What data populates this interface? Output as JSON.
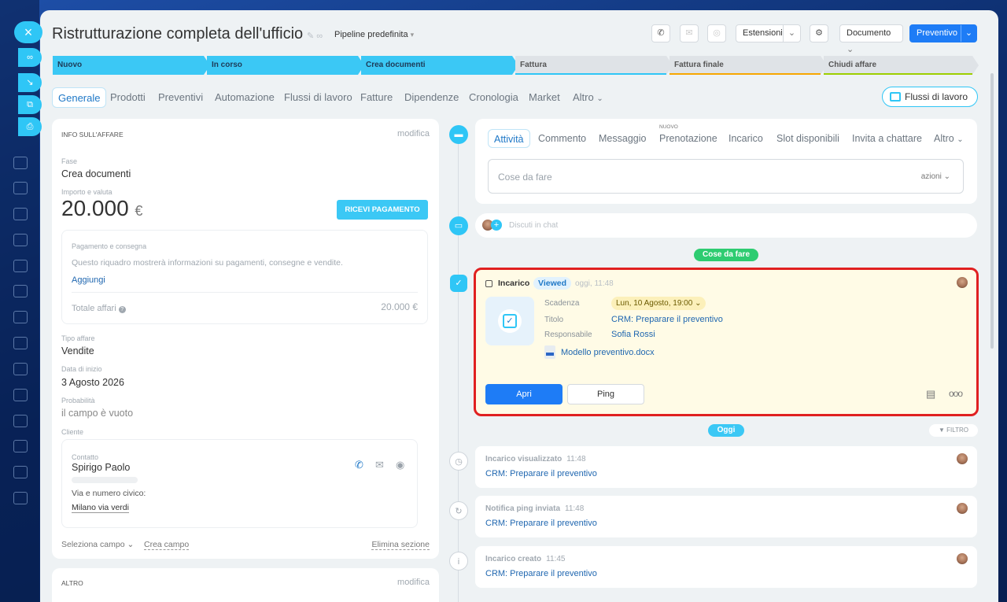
{
  "header": {
    "title": "Ristrutturazione completa dell'ufficio",
    "pipeline": "Pipeline predefinita",
    "extensions": "Estensioni",
    "document": "Documento",
    "quote": "Preventivo"
  },
  "stages": [
    {
      "label": "Nuovo",
      "active": true
    },
    {
      "label": "In corso",
      "active": true
    },
    {
      "label": "Crea documenti",
      "active": true
    },
    {
      "label": "Fattura",
      "active": false,
      "color": "#2fc6f6"
    },
    {
      "label": "Fattura finale",
      "active": false,
      "color": "#f7a700"
    },
    {
      "label": "Chiudi affare",
      "active": false,
      "color": "#9dcf00"
    }
  ],
  "tabs": [
    "Generale",
    "Prodotti",
    "Preventivi",
    "Automazione",
    "Flussi di lavoro",
    "Fatture",
    "Dipendenze",
    "Cronologia",
    "Market",
    "Altro"
  ],
  "workflows_button": "Flussi di lavoro",
  "deal_info": {
    "heading": "INFO SULL'AFFARE",
    "edit": "modifica",
    "stage_label": "Fase",
    "stage_value": "Crea documenti",
    "amount_label": "Importo e valuta",
    "amount": "20.000",
    "currency": "€",
    "receive_payment": "RICEVI PAGAMENTO",
    "payment": {
      "heading": "Pagamento e consegna",
      "description": "Questo riquadro mostrerà informazioni su pagamenti, consegne e vendite.",
      "add": "Aggiungi",
      "total_label": "Totale affari",
      "total_value": "20.000 €"
    },
    "type_label": "Tipo affare",
    "type_value": "Vendite",
    "start_label": "Data di inizio",
    "start_value": "3 Agosto 2026",
    "prob_label": "Probabilità",
    "prob_value": "il campo è vuoto",
    "client_label": "Cliente",
    "contact": {
      "label": "Contatto",
      "name": "Spirigo Paolo",
      "address_label": "Via e numero civico:",
      "address": "Milano via verdi"
    },
    "select_field": "Seleziona campo",
    "create_field": "Crea campo",
    "delete_section": "Elimina sezione"
  },
  "other_section": {
    "heading": "ALTRO",
    "edit": "modifica"
  },
  "activity": {
    "tabs": [
      "Attività",
      "Commento",
      "Messaggio",
      "Prenotazione",
      "Incarico",
      "Slot disponibili",
      "Invita a chattare",
      "Altro"
    ],
    "new_badge": "NUOVO",
    "todo_placeholder": "Cose da fare",
    "actions": "azioni",
    "chat_placeholder": "Discuti in chat"
  },
  "todo_pill": "Cose da fare",
  "task": {
    "type": "Incarico",
    "status": "Viewed",
    "time": "oggi, 11:48",
    "deadline_label": "Scadenza",
    "deadline": "Lun, 10 Agosto, 19:00",
    "title_label": "Titolo",
    "title": "CRM: Preparare il preventivo",
    "responsible_label": "Responsabile",
    "responsible": "Sofia Rossi",
    "file": "Modello preventivo.docx",
    "open": "Apri",
    "ping": "Ping"
  },
  "today_pill": "Oggi",
  "filter": "FILTRO",
  "history": [
    {
      "title": "Incarico visualizzato",
      "time": "11:48",
      "link": "CRM: Preparare il preventivo"
    },
    {
      "title": "Notifica ping inviata",
      "time": "11:48",
      "link": "CRM: Preparare il preventivo"
    },
    {
      "title": "Incarico creato",
      "time": "11:45",
      "link": "CRM: Preparare il preventivo"
    }
  ],
  "colors": {
    "accent": "#2fc6f6",
    "primary": "#1e7cf6",
    "highlight_border": "#e02020",
    "task_bg": "#fffbe6"
  }
}
